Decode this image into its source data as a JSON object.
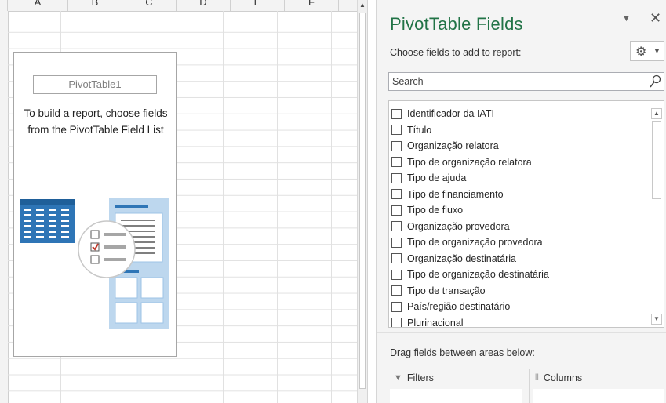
{
  "spreadsheet": {
    "columns": [
      "A",
      "B",
      "C",
      "D",
      "E",
      "F"
    ],
    "pivot_placeholder": {
      "name": "PivotTable1",
      "instructions": "To build a report, choose fields from the PivotTable Field List"
    }
  },
  "pane": {
    "title": "PivotTable Fields",
    "choose_label": "Choose fields to add to report:",
    "search_placeholder": "Search",
    "fields": [
      "Identificador da IATI",
      "Título",
      "Organização relatora",
      "Tipo de organização relatora",
      "Tipo de ajuda",
      "Tipo de financiamento",
      "Tipo de fluxo",
      "Organização provedora",
      "Tipo de organização provedora",
      "Organização destinatária",
      "Tipo de organização destinatária",
      "Tipo de transação",
      "País/região destinatário",
      "Plurinacional"
    ],
    "drag_label": "Drag fields between areas below:",
    "areas": {
      "filters": "Filters",
      "columns": "Columns"
    }
  },
  "colors": {
    "title_green": "#217346",
    "illustration_blue": "#2e75b6",
    "illustration_light": "#bdd7ee",
    "check_red": "#c0392b"
  },
  "icons": {
    "pane_menu": "chevron-down-icon",
    "close": "close-icon",
    "settings": "gear-icon",
    "search": "search-icon",
    "filters": "filter-icon",
    "columns": "columns-icon"
  }
}
